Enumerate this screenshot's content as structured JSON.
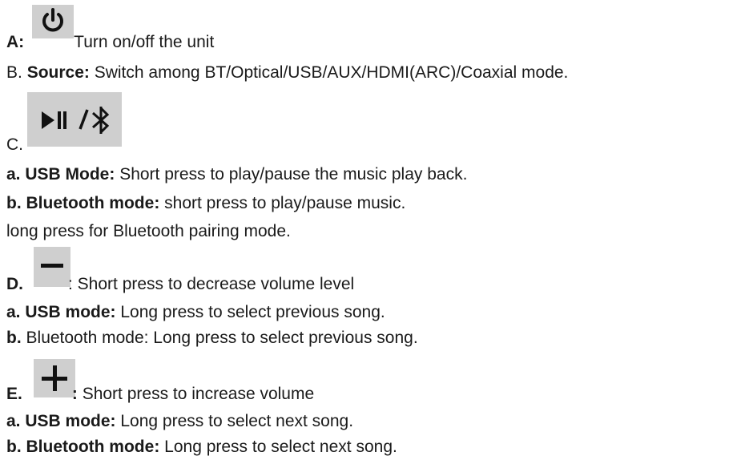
{
  "sections": {
    "a": {
      "prefix": "A:",
      "icon": "power-icon",
      "text": "Turn on/off the unit"
    },
    "b": {
      "prefix": "B.",
      "bold_label": "Source:",
      "text": "Switch among BT/Optical/USB/AUX/HDMI(ARC)/Coaxial mode."
    },
    "c": {
      "prefix": "C.",
      "icon": "play-pause-bluetooth-icon",
      "items": [
        {
          "bold_label": "a. USB Mode:",
          "text": "Short press to play/pause the music play back.",
          "plain_prefix": ""
        },
        {
          "bold_label": "b. Bluetooth mode:",
          "text": "short press to play/pause music."
        }
      ],
      "continuation": "long press for Bluetooth pairing mode."
    },
    "d": {
      "prefix": "D.",
      "icon": "minus-icon",
      "text": ": Short press to decrease volume level",
      "items": [
        {
          "bold_label": "a. USB mode:",
          "text": "Long press to select previous song."
        },
        {
          "bold_label": "b.",
          "text": "Bluetooth mode: Long press to select previous song."
        }
      ]
    },
    "e": {
      "prefix": "E.",
      "icon": "plus-icon",
      "bold_colon": ":",
      "text": "Short press to increase volume",
      "items": [
        {
          "bold_label": "a. USB mode:",
          "text": "Long press to select next song."
        },
        {
          "bold_label": "b. Bluetooth mode:",
          "text": "Long press to select next song."
        }
      ]
    }
  },
  "colors": {
    "text": "#1a1a1a",
    "icon_background": "#cfcfcf",
    "icon_glyph": "#111111"
  }
}
